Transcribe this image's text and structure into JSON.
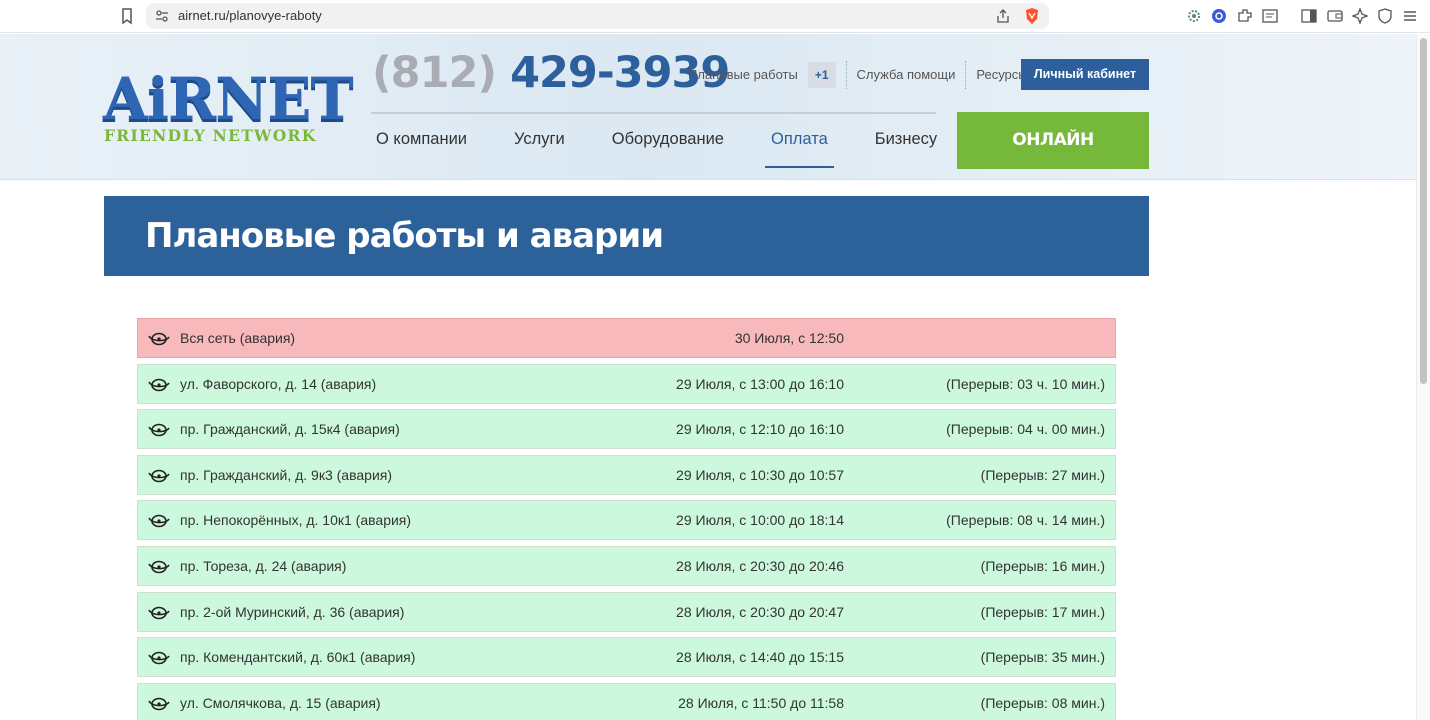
{
  "browser": {
    "url": "airnet.ru/planovye-raboty",
    "brand_color": "#fb542b"
  },
  "header": {
    "logo_main": "AiRNET",
    "logo_tagline": "FRIENDLY NETWORK",
    "phone_code": "(812)",
    "phone_number": "429-3939",
    "top_links": {
      "planned": "Плановые работы",
      "planned_badge": "+1",
      "help": "Служба помощи",
      "resources": "Ресурсы"
    },
    "cabinet_label": "Личный кабинет",
    "menu": [
      {
        "label": "О компании"
      },
      {
        "label": "Услуги"
      },
      {
        "label": "Оборудование"
      },
      {
        "label": "Оплата",
        "active": true
      },
      {
        "label": "Бизнесу"
      }
    ],
    "register_label": "ОНЛАЙН РЕГИСТРАЦИЯ"
  },
  "page_title": "Плановые работы и аварии",
  "events": [
    {
      "address": "Вся сеть (авария)",
      "time": "30 Июля, с 12:50",
      "break": "",
      "status": "red"
    },
    {
      "address": "ул. Фаворского, д. 14 (авария)",
      "time": "29 Июля, с 13:00 до 16:10",
      "break": "(Перерыв: 03 ч. 10 мин.)",
      "status": "green"
    },
    {
      "address": "пр. Гражданский, д. 15к4 (авария)",
      "time": "29 Июля, с 12:10 до 16:10",
      "break": "(Перерыв: 04 ч. 00 мин.)",
      "status": "green"
    },
    {
      "address": "пр. Гражданский, д. 9к3 (авария)",
      "time": "29 Июля, с 10:30 до 10:57",
      "break": "(Перерыв: 27 мин.)",
      "status": "green"
    },
    {
      "address": "пр. Непокорённых, д. 10к1 (авария)",
      "time": "29 Июля, с 10:00 до 18:14",
      "break": "(Перерыв: 08 ч. 14 мин.)",
      "status": "green"
    },
    {
      "address": "пр. Тореза, д. 24 (авария)",
      "time": "28 Июля, с 20:30 до 20:46",
      "break": "(Перерыв: 16 мин.)",
      "status": "green"
    },
    {
      "address": "пр. 2-ой Муринский, д. 36 (авария)",
      "time": "28 Июля, с 20:30 до 20:47",
      "break": "(Перерыв: 17 мин.)",
      "status": "green"
    },
    {
      "address": "пр. Комендантский, д. 60к1 (авария)",
      "time": "28 Июля, с 14:40 до 15:15",
      "break": "(Перерыв: 35 мин.)",
      "status": "green"
    },
    {
      "address": "ул. Смолячкова, д. 15 (авария)",
      "time": "28 Июля, с 11:50 до 11:58",
      "break": "(Перерыв: 08 мин.)",
      "status": "green"
    }
  ],
  "colors": {
    "accent_blue": "#2c5f9b",
    "accent_green": "#76b83a",
    "row_green": "#ccf9dd",
    "row_red": "#f7b9bb"
  }
}
